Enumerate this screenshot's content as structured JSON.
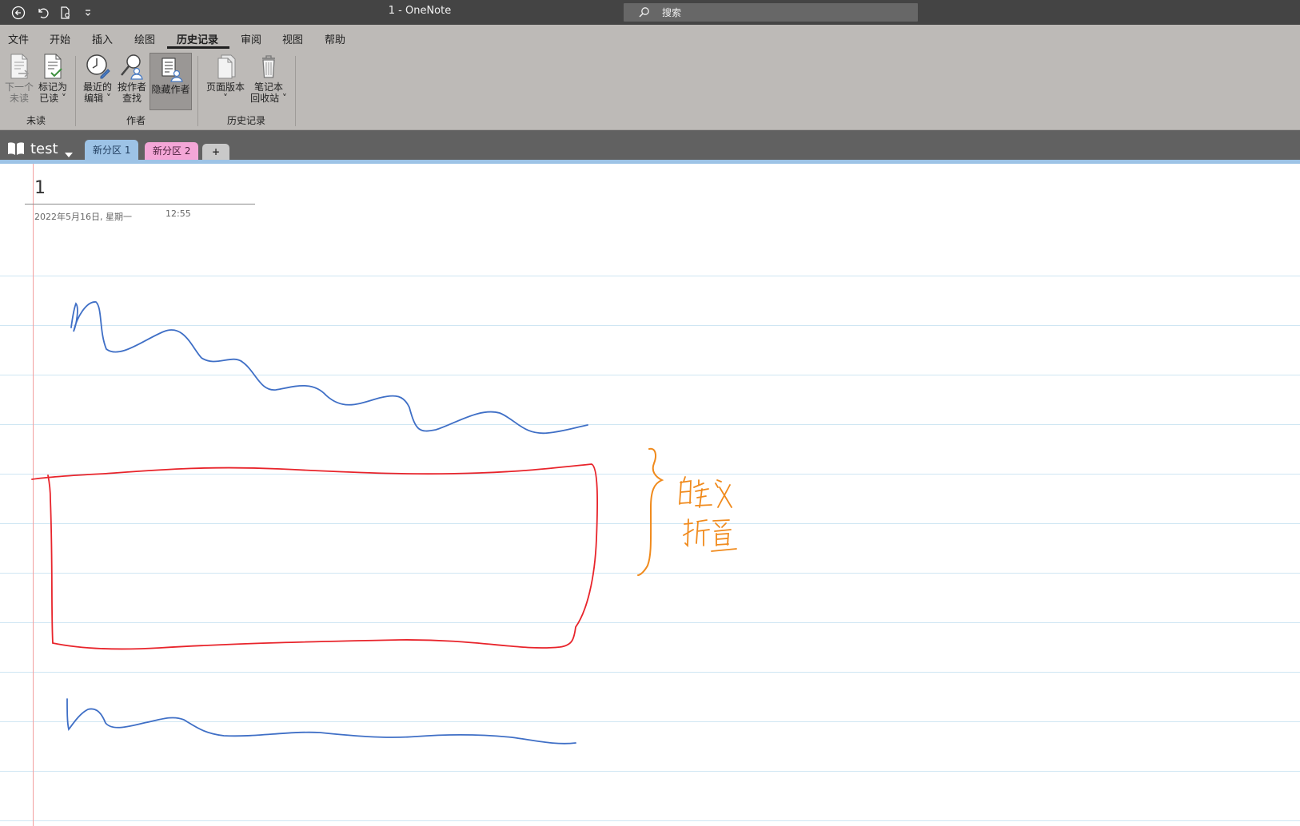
{
  "window": {
    "title": "1  -  OneNote",
    "search_placeholder": "搜索"
  },
  "menu": {
    "tabs": [
      "文件",
      "开始",
      "插入",
      "绘图",
      "历史记录",
      "审阅",
      "视图",
      "帮助"
    ],
    "active": "历史记录"
  },
  "ribbon": {
    "unread": {
      "label": "未读",
      "next_unread": [
        "下一个",
        "未读"
      ],
      "mark_read": [
        "标记为",
        "已读 ˅"
      ]
    },
    "author": {
      "label": "作者",
      "recent_edits": [
        "最近的",
        "编辑 ˅"
      ],
      "find_by_author": [
        "按作者",
        "查找"
      ],
      "hide_authors": "隐藏作者"
    },
    "history": {
      "label": "历史记录",
      "page_versions": [
        "页面版本",
        "˅"
      ],
      "notebook_recycle": [
        "笔记本",
        "回收站 ˅"
      ]
    }
  },
  "notebook": {
    "name": "test",
    "sections": [
      "新分区 1",
      "新分区 2"
    ],
    "add_label": "+"
  },
  "page": {
    "title": "1",
    "date": "2022年5月16日, 星期一",
    "time": "12:55",
    "handwriting": "自定义 折叠"
  },
  "colors": {
    "titlebar": "#444444",
    "ribbon": "#bdbab7",
    "section1": "#9dc3e6",
    "section2": "#f4a6d7",
    "ink_blue": "#3f6fc6",
    "ink_red": "#e8242b",
    "ink_orange": "#f08a1c"
  }
}
